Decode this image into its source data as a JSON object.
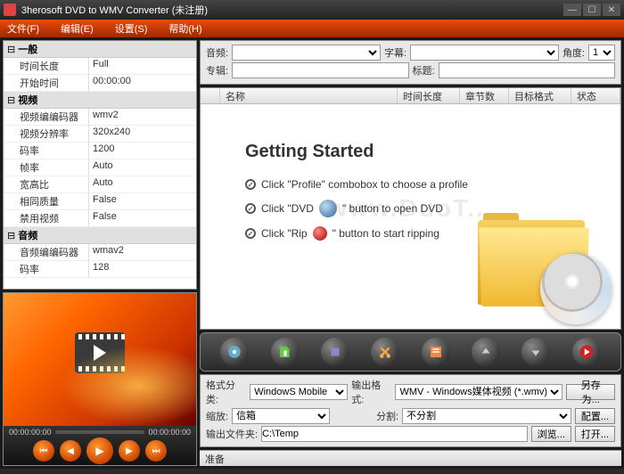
{
  "window": {
    "title": "3herosoft DVD to WMV Converter (未注册)"
  },
  "menu": {
    "file": "文件(F)",
    "edit": "编辑(E)",
    "settings": "设置(S)",
    "help": "帮助(H)"
  },
  "props": {
    "groups": [
      {
        "label": "一般",
        "rows": [
          {
            "key": "时间长度",
            "val": "Full"
          },
          {
            "key": "开始时间",
            "val": "00:00:00"
          }
        ]
      },
      {
        "label": "视频",
        "rows": [
          {
            "key": "视频编编码器",
            "val": "wmv2"
          },
          {
            "key": "视频分辨率",
            "val": "320x240"
          },
          {
            "key": "码率",
            "val": "1200"
          },
          {
            "key": "帧率",
            "val": "Auto"
          },
          {
            "key": "宽高比",
            "val": "Auto"
          },
          {
            "key": "相同质量",
            "val": "False"
          },
          {
            "key": "禁用视频",
            "val": "False"
          }
        ]
      },
      {
        "label": "音频",
        "rows": [
          {
            "key": "音频编编码器",
            "val": "wmav2"
          },
          {
            "key": "码率",
            "val": "128"
          }
        ]
      }
    ]
  },
  "preview": {
    "time_current": "00:00:00:00",
    "time_total": "00:00:00:00"
  },
  "top_fields": {
    "audio_label": "音频:",
    "subtitle_label": "字幕:",
    "angle_label": "角度:",
    "angle_value": "1",
    "album_label": "专辑:",
    "title_label": "标题:"
  },
  "columns": {
    "name": "名称",
    "duration": "时间长度",
    "chapters": "章节数",
    "target_format": "目标格式",
    "status": "状态"
  },
  "getting_started": {
    "heading": "Getting Started",
    "line1a": "Click \"Profile\" combobox to choose a profile",
    "line2a": "Click \"DVD",
    "line2b": "\" button to open DVD",
    "line3a": "Click \"Rip",
    "line3b": "\" button to start ripping"
  },
  "bottom_fields": {
    "format_cat_label": "格式分类:",
    "format_cat_value": "WindowS Mobile",
    "output_format_label": "输出格式:",
    "output_format_value": "WMV - Windows媒体视频 (*.wmv)",
    "saveas_btn": "另存为...",
    "zoom_label": "缩放:",
    "zoom_value": "信箱",
    "split_label": "分割:",
    "split_value": "不分割",
    "config_btn": "配置...",
    "output_folder_label": "输出文件夹:",
    "output_folder_value": "C:\\Temp",
    "browse_btn": "浏览...",
    "open_btn": "打开..."
  },
  "status": {
    "ready": "准备"
  },
  "watermark": "www.DuoT..."
}
